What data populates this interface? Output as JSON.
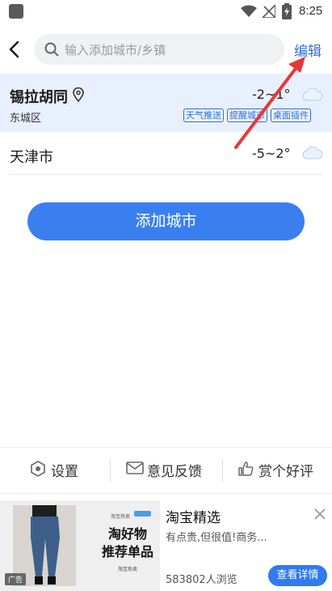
{
  "status_bar": {
    "time": "8:25"
  },
  "header": {
    "search_placeholder": "输入添加城市/乡镇",
    "edit_label": "编辑"
  },
  "cities": [
    {
      "name": "锡拉胡同",
      "district": "东城区",
      "temp": "-2~1°",
      "weather_icon": "cloud-icon",
      "tags": [
        "天气推送",
        "提醒城市",
        "桌面插件"
      ]
    },
    {
      "name": "天津市",
      "temp": "-5~2°",
      "weather_icon": "cloud-icon"
    }
  ],
  "add_city_label": "添加城市",
  "toolbar": {
    "settings_label": "设置",
    "feedback_label": "意见反馈",
    "rate_label": "赏个好评"
  },
  "ad": {
    "image_small_label": "淘宝热卖",
    "image_headline_line1": "淘好物",
    "image_headline_line2": "推荐单品",
    "image_sub_label": "淘宝热卖",
    "badge": "广告",
    "title": "淘宝精选",
    "description": "有点贵,但很值!商务...",
    "views": "583802人浏览",
    "cta": "查看详情"
  },
  "colors": {
    "accent": "#3a7ff0",
    "link": "#2f6fd8",
    "selected_row_bg": "#e8f0fd",
    "annotation_arrow": "#e53935"
  }
}
